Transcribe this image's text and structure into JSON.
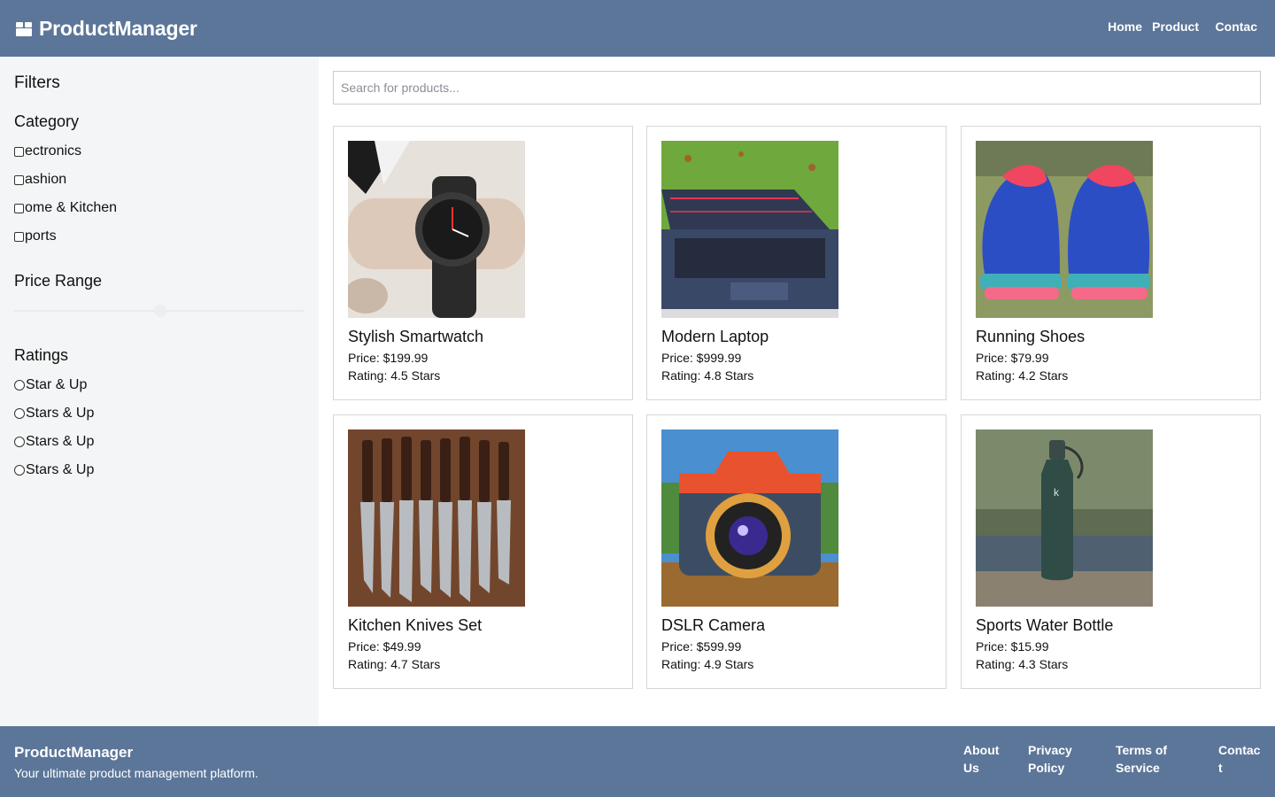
{
  "header": {
    "brand": "ProductManager",
    "nav": [
      "Home",
      "Product",
      "Contac"
    ]
  },
  "sidebar": {
    "title": "Filters",
    "category_title": "Category",
    "categories": [
      "ectronics",
      "ashion",
      "ome & Kitchen",
      "ports"
    ],
    "price_title": "Price Range",
    "ratings_title": "Ratings",
    "ratings": [
      "Star & Up",
      "Stars & Up",
      "Stars & Up",
      "Stars & Up"
    ]
  },
  "search": {
    "placeholder": "Search for products..."
  },
  "products": [
    {
      "name": "Stylish Smartwatch",
      "price": "Price: $199.99",
      "rating": "Rating: 4.5 Stars"
    },
    {
      "name": "Modern Laptop",
      "price": "Price: $999.99",
      "rating": "Rating: 4.8 Stars"
    },
    {
      "name": "Running Shoes",
      "price": "Price: $79.99",
      "rating": "Rating: 4.2 Stars"
    },
    {
      "name": "Kitchen Knives Set",
      "price": "Price: $49.99",
      "rating": "Rating: 4.7 Stars"
    },
    {
      "name": "DSLR Camera",
      "price": "Price: $599.99",
      "rating": "Rating: 4.9 Stars"
    },
    {
      "name": "Sports Water Bottle",
      "price": "Price: $15.99",
      "rating": "Rating: 4.3 Stars"
    }
  ],
  "footer": {
    "brand": "ProductManager",
    "tagline": "Your ultimate product management platform.",
    "links": [
      "About Us",
      "Privacy Policy",
      "Terms of Service",
      "Contac t"
    ]
  },
  "colors": {
    "header_bg": "#5c7699",
    "sidebar_bg": "#f4f5f6"
  },
  "icons": {
    "brand": "package-icon"
  }
}
